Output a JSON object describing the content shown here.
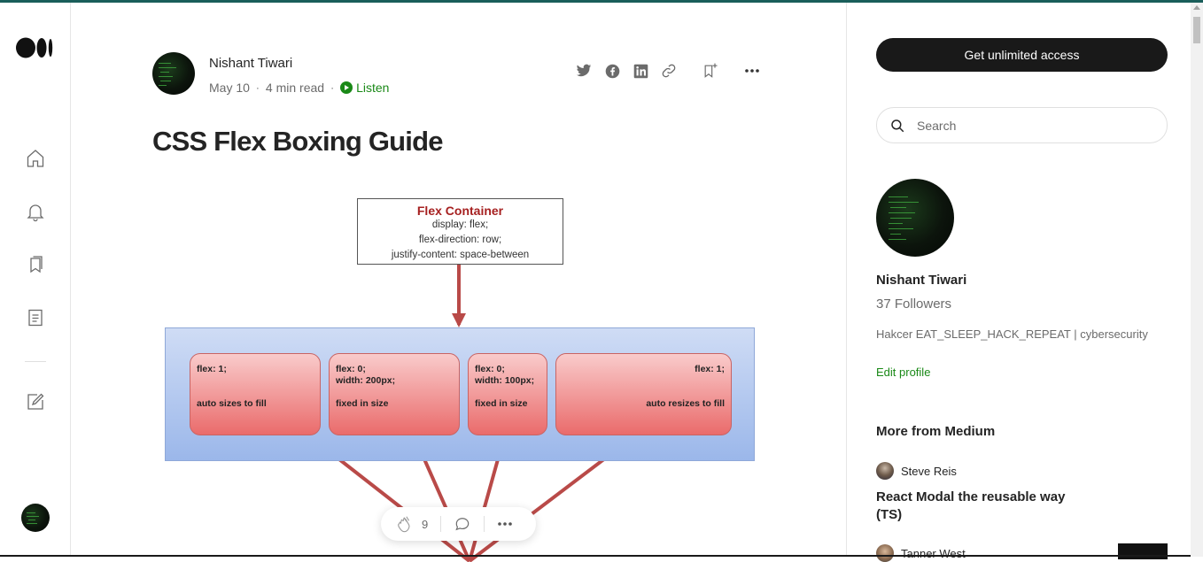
{
  "nav": {
    "items": [
      {
        "name": "home-icon"
      },
      {
        "name": "bell-icon"
      },
      {
        "name": "bookmarks-icon"
      },
      {
        "name": "stories-icon"
      },
      {
        "name": "write-icon"
      }
    ]
  },
  "article": {
    "author": "Nishant Tiwari",
    "date": "May 10",
    "read_time": "4 min read",
    "listen_label": "Listen",
    "title": "CSS Flex Boxing Guide",
    "share_icons": [
      "twitter-icon",
      "facebook-icon",
      "linkedin-icon",
      "link-icon"
    ]
  },
  "diagram": {
    "container_title": "Flex Container",
    "container_lines": [
      "display: flex;",
      "flex-direction: row;",
      "justify-content: space-between"
    ],
    "items": [
      {
        "line1": "flex: 1;",
        "line2": "",
        "line3": "auto sizes to fill"
      },
      {
        "line1": "flex: 0;",
        "line2": "width: 200px;",
        "line3": "fixed in size"
      },
      {
        "line1": "flex: 0;",
        "line2": "width: 100px;",
        "line3": "fixed in size"
      },
      {
        "line1": "flex: 1;",
        "line2": "",
        "line3": "auto resizes to fill"
      }
    ]
  },
  "clap_bar": {
    "claps": "9"
  },
  "sidebar": {
    "cta_label": "Get unlimited access",
    "search_placeholder": "Search",
    "author_name": "Nishant Tiwari",
    "followers": "37 Followers",
    "bio": "Hakcer EAT_SLEEP_HACK_REPEAT | cybersecurity",
    "edit_label": "Edit profile",
    "more_title": "More from Medium",
    "recommendations": [
      {
        "author": "Steve Reis",
        "title": "React Modal the reusable way (TS)"
      },
      {
        "author": "Tanner West",
        "title": ""
      }
    ]
  },
  "colors": {
    "accent_green": "#1a8917",
    "cta_bg": "#191919",
    "container_title": "#a62020",
    "arrow": "#b94a48"
  }
}
